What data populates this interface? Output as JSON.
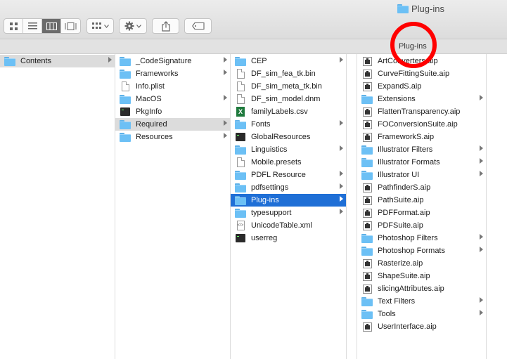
{
  "window": {
    "title": "Plug-ins"
  },
  "pathbar": {
    "label": "Plug-ins"
  },
  "columns": [
    {
      "id": "col1",
      "items": [
        {
          "name": "Contents",
          "icon": "folder",
          "has_children": true,
          "selected": "gray"
        }
      ]
    },
    {
      "id": "col2",
      "items": [
        {
          "name": "_CodeSignature",
          "icon": "folder",
          "has_children": true
        },
        {
          "name": "Frameworks",
          "icon": "folder",
          "has_children": true
        },
        {
          "name": "Info.plist",
          "icon": "document",
          "has_children": false
        },
        {
          "name": "MacOS",
          "icon": "folder",
          "has_children": true
        },
        {
          "name": "PkgInfo",
          "icon": "executable",
          "has_children": false
        },
        {
          "name": "Required",
          "icon": "folder",
          "has_children": true,
          "selected": "gray"
        },
        {
          "name": "Resources",
          "icon": "folder",
          "has_children": true
        }
      ]
    },
    {
      "id": "col3",
      "items": [
        {
          "name": "CEP",
          "icon": "folder",
          "has_children": true
        },
        {
          "name": "DF_sim_fea_tk.bin",
          "icon": "document",
          "has_children": false
        },
        {
          "name": "DF_sim_meta_tk.bin",
          "icon": "document",
          "has_children": false
        },
        {
          "name": "DF_sim_model.dnm",
          "icon": "document",
          "has_children": false
        },
        {
          "name": "familyLabels.csv",
          "icon": "csv",
          "has_children": false
        },
        {
          "name": "Fonts",
          "icon": "folder",
          "has_children": true
        },
        {
          "name": "GlobalResources",
          "icon": "executable",
          "has_children": false
        },
        {
          "name": "Linguistics",
          "icon": "folder",
          "has_children": true
        },
        {
          "name": "Mobile.presets",
          "icon": "document",
          "has_children": false
        },
        {
          "name": "PDFL Resource",
          "icon": "folder",
          "has_children": true
        },
        {
          "name": "pdfsettings",
          "icon": "folder",
          "has_children": true
        },
        {
          "name": "Plug-ins",
          "icon": "folder",
          "has_children": true,
          "selected": "blue"
        },
        {
          "name": "typesupport",
          "icon": "folder",
          "has_children": true
        },
        {
          "name": "UnicodeTable.xml",
          "icon": "xml",
          "has_children": false
        },
        {
          "name": "userreg",
          "icon": "executable",
          "has_children": false
        }
      ]
    },
    {
      "id": "col4",
      "items": [
        {
          "name": "ArtConverters.aip",
          "icon": "plugin",
          "has_children": false
        },
        {
          "name": "CurveFittingSuite.aip",
          "icon": "plugin",
          "has_children": false
        },
        {
          "name": "ExpandS.aip",
          "icon": "plugin",
          "has_children": false
        },
        {
          "name": "Extensions",
          "icon": "folder",
          "has_children": true
        },
        {
          "name": "FlattenTransparency.aip",
          "icon": "plugin",
          "has_children": false
        },
        {
          "name": "FOConversionSuite.aip",
          "icon": "plugin",
          "has_children": false
        },
        {
          "name": "FrameworkS.aip",
          "icon": "plugin",
          "has_children": false
        },
        {
          "name": "Illustrator Filters",
          "icon": "folder",
          "has_children": true
        },
        {
          "name": "Illustrator Formats",
          "icon": "folder",
          "has_children": true
        },
        {
          "name": "Illustrator UI",
          "icon": "folder",
          "has_children": true
        },
        {
          "name": "PathfinderS.aip",
          "icon": "plugin",
          "has_children": false
        },
        {
          "name": "PathSuite.aip",
          "icon": "plugin",
          "has_children": false
        },
        {
          "name": "PDFFormat.aip",
          "icon": "plugin",
          "has_children": false
        },
        {
          "name": "PDFSuite.aip",
          "icon": "plugin",
          "has_children": false
        },
        {
          "name": "Photoshop Filters",
          "icon": "folder",
          "has_children": true
        },
        {
          "name": "Photoshop Formats",
          "icon": "folder",
          "has_children": true
        },
        {
          "name": "Rasterize.aip",
          "icon": "plugin",
          "has_children": false
        },
        {
          "name": "ShapeSuite.aip",
          "icon": "plugin",
          "has_children": false
        },
        {
          "name": "slicingAttributes.aip",
          "icon": "plugin",
          "has_children": false
        },
        {
          "name": "Text Filters",
          "icon": "folder",
          "has_children": true
        },
        {
          "name": "Tools",
          "icon": "folder",
          "has_children": true
        },
        {
          "name": "UserInterface.aip",
          "icon": "plugin",
          "has_children": false
        }
      ]
    }
  ],
  "colors": {
    "selection_blue": "#1f6fd6",
    "selection_gray": "#dcdcdc",
    "folder_blue": "#6cc0f5",
    "annotation_red": "#ff0000"
  }
}
